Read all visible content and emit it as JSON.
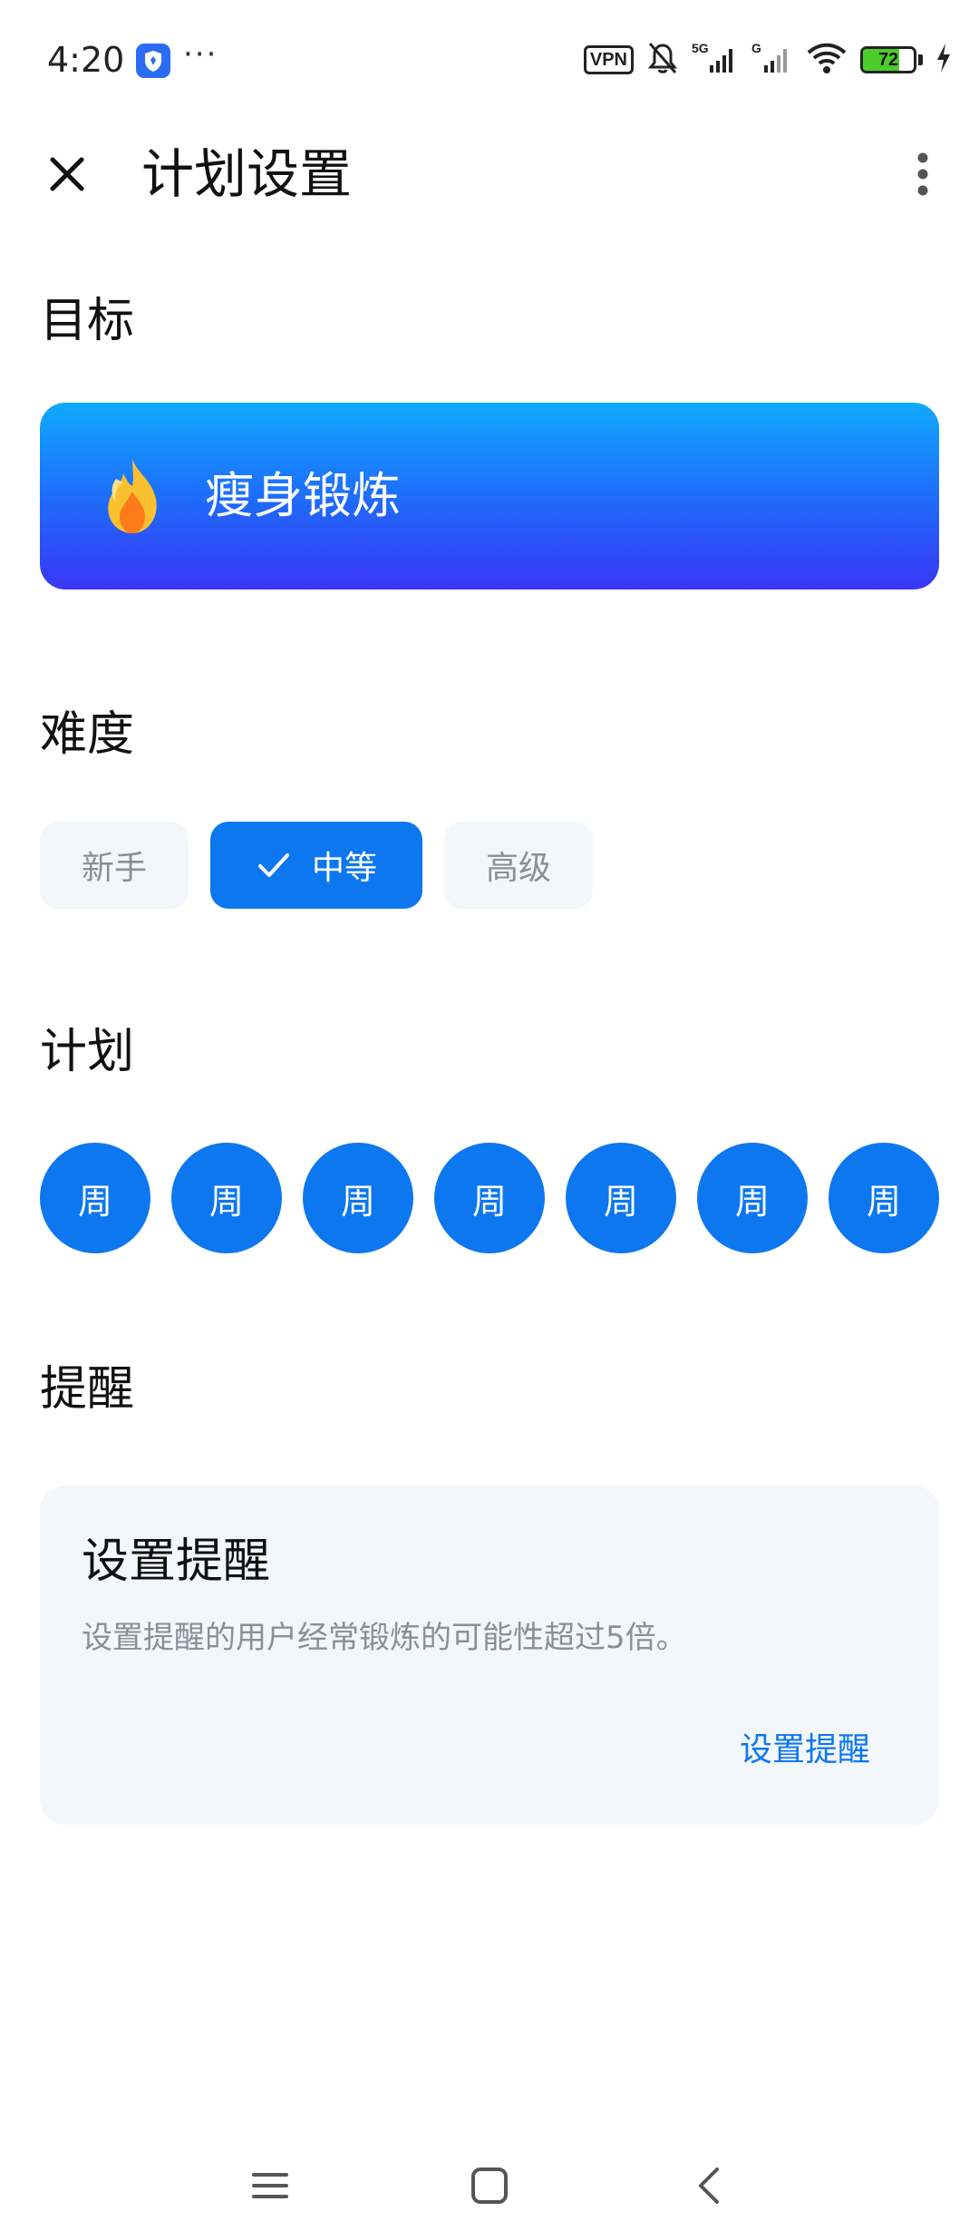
{
  "status_bar": {
    "time": "4:20",
    "dots": "···",
    "vpn": "VPN",
    "net_5g": "5G",
    "net_g": "G",
    "battery": "72",
    "battery_level": 0.72
  },
  "header": {
    "title": "计划设置"
  },
  "goal": {
    "heading": "目标",
    "label": "瘦身锻炼",
    "icon": "flame-icon"
  },
  "difficulty": {
    "heading": "难度",
    "options": [
      "新手",
      "中等",
      "高级"
    ],
    "selected": "中等"
  },
  "plan": {
    "heading": "计划",
    "days": [
      "周",
      "周",
      "周",
      "周",
      "周",
      "周",
      "周"
    ]
  },
  "reminder": {
    "heading": "提醒",
    "title": "设置提醒",
    "description": "设置提醒的用户经常锻炼的可能性超过5倍。",
    "action": "设置提醒"
  },
  "colors": {
    "accent": "#0d77f0",
    "chip_bg": "#f3f6fb",
    "gradient_top": "#10aafd",
    "gradient_bottom": "#3a36f5"
  }
}
